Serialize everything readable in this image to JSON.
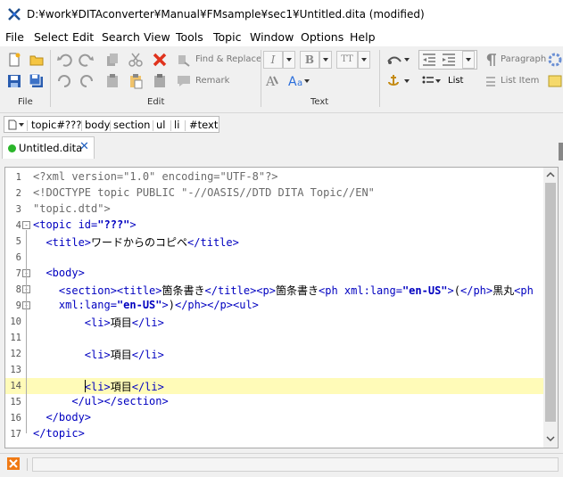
{
  "window": {
    "title": "D:¥work¥DITAconverter¥Manual¥FMsample¥sec1¥Untitled.dita (modified)"
  },
  "menu": [
    "File",
    "Select",
    "Edit",
    "Search",
    "View",
    "Tools",
    "Topic",
    "Window",
    "Options",
    "Help"
  ],
  "toolbar": {
    "groups": {
      "file": "File",
      "edit": "Edit",
      "text": "Text"
    },
    "find_replace": "Find & Replace",
    "remark": "Remark",
    "paragraph": "Paragraph",
    "list": "List",
    "list_item": "List Item",
    "fmt_italic": "I",
    "fmt_bold": "B",
    "fmt_tt": "TT"
  },
  "breadcrumb": [
    "topic#???",
    "body",
    "section",
    "ul",
    "li",
    "#text"
  ],
  "tab": {
    "label": "Untitled.dita",
    "close": "✕"
  },
  "editor": {
    "lines": [
      {
        "n": "1",
        "segs": [
          [
            "pi",
            "<?xml version=\"1.0\" encoding=\"UTF-8\"?>"
          ]
        ]
      },
      {
        "n": "2",
        "segs": [
          [
            "doc",
            "<!DOCTYPE topic PUBLIC \"-//OASIS//DTD DITA Topic//EN\""
          ]
        ]
      },
      {
        "n": "3",
        "segs": [
          [
            "doc",
            "\"topic.dtd\">"
          ]
        ]
      },
      {
        "n": "4",
        "fold": "-",
        "segs": [
          [
            "tag",
            "<topic "
          ],
          [
            "attr",
            "id="
          ],
          [
            "val",
            "\"???\""
          ],
          [
            "tag",
            ">"
          ]
        ]
      },
      {
        "n": "5",
        "segs": [
          [
            "txt",
            "  "
          ],
          [
            "tag",
            "<title>"
          ],
          [
            "txt",
            "ワードからのコピペ"
          ],
          [
            "tag",
            "</title>"
          ]
        ]
      },
      {
        "n": "6",
        "segs": []
      },
      {
        "n": "7",
        "fold": "-",
        "segs": [
          [
            "txt",
            "  "
          ],
          [
            "tag",
            "<body>"
          ]
        ]
      },
      {
        "n": "8",
        "fold": "-",
        "segs": [
          [
            "txt",
            "    "
          ],
          [
            "tag",
            "<section><title>"
          ],
          [
            "txt",
            "箇条書き"
          ],
          [
            "tag",
            "</title><p>"
          ],
          [
            "txt",
            "箇条書き"
          ],
          [
            "tag",
            "<ph "
          ],
          [
            "attr",
            "xml:lang="
          ],
          [
            "val",
            "\"en-US\""
          ],
          [
            "tag",
            ">"
          ],
          [
            "txt",
            "("
          ],
          [
            "tag",
            "</ph>"
          ],
          [
            "txt",
            "黒丸"
          ],
          [
            "tag",
            "<ph"
          ]
        ]
      },
      {
        "n": "9",
        "fold": "-",
        "segs": [
          [
            "txt",
            "    "
          ],
          [
            "attr",
            "xml:lang="
          ],
          [
            "val",
            "\"en-US\""
          ],
          [
            "tag",
            ">"
          ],
          [
            "txt",
            ")"
          ],
          [
            "tag",
            "</ph></p><ul>"
          ]
        ]
      },
      {
        "n": "10",
        "segs": [
          [
            "txt",
            "        "
          ],
          [
            "tag",
            "<li>"
          ],
          [
            "txt",
            "項目"
          ],
          [
            "tag",
            "</li>"
          ]
        ]
      },
      {
        "n": "11",
        "segs": []
      },
      {
        "n": "12",
        "segs": [
          [
            "txt",
            "        "
          ],
          [
            "tag",
            "<li>"
          ],
          [
            "txt",
            "項目"
          ],
          [
            "tag",
            "</li>"
          ]
        ]
      },
      {
        "n": "13",
        "segs": []
      },
      {
        "n": "14",
        "highlight": true,
        "segs": [
          [
            "txt",
            "        "
          ],
          [
            "tag",
            "<li>"
          ],
          [
            "txt",
            "項目"
          ],
          [
            "tag",
            "</li>"
          ]
        ]
      },
      {
        "n": "15",
        "segs": [
          [
            "txt",
            "      "
          ],
          [
            "tag",
            "</ul></section>"
          ]
        ]
      },
      {
        "n": "16",
        "segs": [
          [
            "txt",
            "  "
          ],
          [
            "tag",
            "</body>"
          ]
        ]
      },
      {
        "n": "17",
        "segs": [
          [
            "tag",
            "</topic>"
          ]
        ]
      }
    ],
    "current_line_color": "#fffbb8"
  },
  "colors": {
    "tag": "#0000c0",
    "accent": "#2a6edb"
  }
}
